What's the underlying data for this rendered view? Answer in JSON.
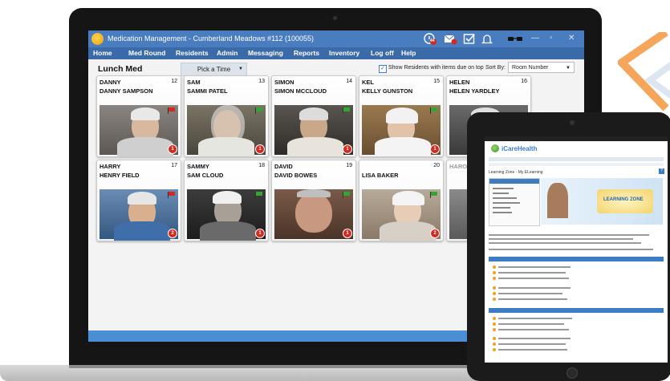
{
  "window": {
    "title": "Medication Management - Cumberland Meadows #112 (100055)",
    "alerts_count": "44"
  },
  "menu": [
    "Home",
    "Med Round",
    "Residents",
    "Admin",
    "Messaging",
    "Reports",
    "Inventory",
    "Log off",
    "Help"
  ],
  "toolbar": {
    "round_label": "Lunch Med",
    "pick_time_label": "Pick a Time",
    "show_due_label": "Show Residents with items due on top",
    "sort_by_label": "Sort By:",
    "sort_value": "Room Number"
  },
  "residents": [
    {
      "nick": "DANNY",
      "room": "12",
      "full": "DANNY SAMPSON",
      "flag": "red",
      "badge": "1"
    },
    {
      "nick": "SAM",
      "room": "13",
      "full": "SAMMI PATEL",
      "flag": "green",
      "badge": "1"
    },
    {
      "nick": "SIMON",
      "room": "14",
      "full": "SIMON MCCLOUD",
      "flag": "green",
      "badge": "1"
    },
    {
      "nick": "KEL",
      "room": "15",
      "full": "KELLY GUNSTON",
      "flag": "green",
      "badge": "1"
    },
    {
      "nick": "HELEN",
      "room": "16",
      "full": "HELEN YARDLEY",
      "flag": "",
      "badge": ""
    },
    {
      "nick": "HARRY",
      "room": "17",
      "full": "HENRY FIELD",
      "flag": "red",
      "badge": "2"
    },
    {
      "nick": "SAMMY",
      "room": "18",
      "full": "SAM CLOUD",
      "flag": "green",
      "badge": "1"
    },
    {
      "nick": "DAVID",
      "room": "19",
      "full": "DAVID BOWES",
      "flag": "green",
      "badge": "1"
    },
    {
      "nick": "",
      "room": "20",
      "full": "LISA BAKER",
      "flag": "green",
      "badge": "2"
    },
    {
      "nick": "HARO",
      "room": "",
      "full": "",
      "flag": "",
      "badge": ""
    }
  ],
  "tablet": {
    "brand": "iCareHealth",
    "page_heading": "Learning Zone - My ELearning",
    "banner_text": "LEARNING ZONE",
    "help_label": "?"
  },
  "colors": {
    "titlebar": "#4a7dbf",
    "menubar": "#3b6aa8",
    "badge": "#d32a1f",
    "flag_green": "#2fa82f",
    "flag_red": "#d32a1f",
    "accent_orange": "#f5a65b"
  }
}
